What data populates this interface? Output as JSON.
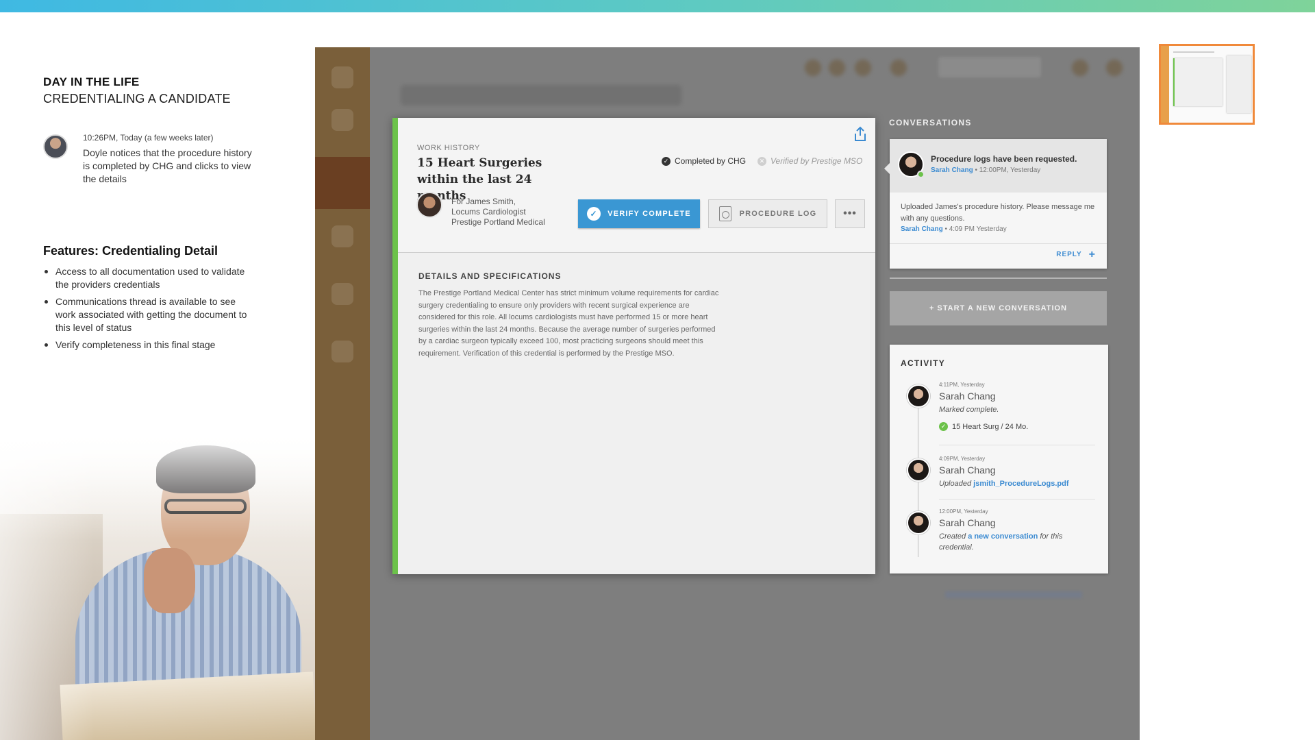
{
  "narrative": {
    "eyebrow": "DAY IN THE LIFE",
    "subtitle": "CREDENTIALING A CANDIDATE",
    "step_time": "10:26PM, Today (a few weeks later)",
    "step_text": "Doyle notices that the procedure history is completed by CHG and clicks to view the details",
    "features_title": "Features: Credentialing Detail",
    "features": [
      "Access to all documentation used to validate the providers credentials",
      "Communications thread is available to see work associated with getting the document to this level of status",
      "Verify completeness in this final stage"
    ]
  },
  "detail": {
    "section_label": "WORK HISTORY",
    "title": "15 Heart Surgeries within the last 24 months",
    "status_chg": "Completed by CHG",
    "status_mso": "Verified by Prestige MSO",
    "candidate_line1": "For James Smith,",
    "candidate_line2": "Locums Cardiologist",
    "candidate_line3": "Prestige Portland Medical",
    "verify_button": "VERIFY COMPLETE",
    "log_button": "PROCEDURE LOG",
    "more_button": "•••",
    "details_title": "DETAILS AND SPECIFICATIONS",
    "details_body": "The Prestige Portland Medical Center has strict minimum volume requirements for cardiac surgery credentialing to ensure only providers with recent surgical experience are considered for this role. All locums cardiologists must have performed 15 or more heart surgeries within the last 24 months. Because the average number of surgeries performed by a cardiac surgeon typically exceed 100, most practicing surgeons should meet this requirement. Verification of this credential is performed by the Prestige MSO."
  },
  "conversations": {
    "title": "CONVERSATIONS",
    "subject": "Procedure logs have been requested.",
    "subject_author": "Sarah Chang",
    "subject_meta": " • 12:00PM, Yesterday",
    "message": "Uploaded James's procedure history. Please message me with any questions.",
    "message_author": "Sarah Chang",
    "message_meta": " • 4:09 PM Yesterday",
    "reply": "REPLY",
    "reply_icon": "+",
    "new_conversation": "+ START A NEW CONVERSATION"
  },
  "activity": {
    "title": "ACTIVITY",
    "items": [
      {
        "time": "4:11PM, Yesterday",
        "name": "Sarah Chang",
        "desc": "Marked complete.",
        "tag": "15 Heart Surg / 24 Mo."
      },
      {
        "time": "4:09PM, Yesterday",
        "name": "Sarah Chang",
        "desc_prefix": "Uploaded ",
        "link": "jsmith_ProcedureLogs.pdf"
      },
      {
        "time": "12:00PM, Yesterday",
        "name": "Sarah Chang",
        "desc_prefix": "Created ",
        "link": "a new conversation",
        "desc_suffix": " for this credential."
      }
    ]
  },
  "colors": {
    "accent_green": "#6cc24a",
    "primary_blue": "#3a97d3",
    "thumbnail_border": "#f0893a"
  }
}
